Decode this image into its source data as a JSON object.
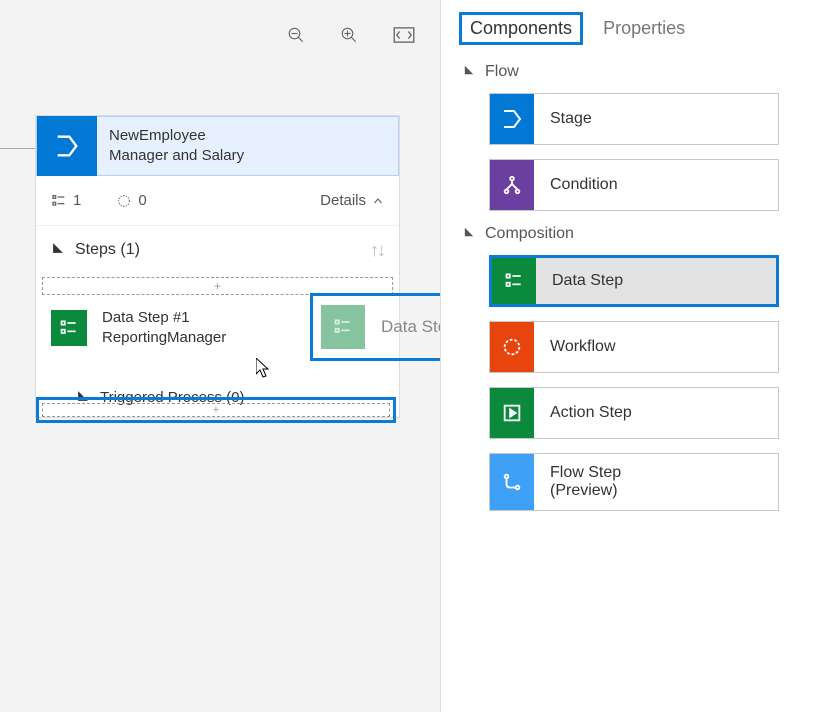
{
  "tabs": {
    "components": "Components",
    "properties": "Properties"
  },
  "sections": {
    "flow": "Flow",
    "composition": "Composition"
  },
  "components": {
    "stage": "Stage",
    "condition": "Condition",
    "data_step": "Data Step",
    "workflow": "Workflow",
    "action_step": "Action Step",
    "flow_step_l1": "Flow Step",
    "flow_step_l2": "(Preview)"
  },
  "stage": {
    "title_l1": "NewEmployee",
    "title_l2": "Manager and Salary",
    "count1": "1",
    "count0": "0",
    "details": "Details",
    "steps_header": "Steps (1)",
    "step1_l1": "Data Step #1",
    "step1_l2": "ReportingManager",
    "triggered": "Triggered Process (0)",
    "plus": "+"
  },
  "drag": {
    "label": "Data Step"
  }
}
